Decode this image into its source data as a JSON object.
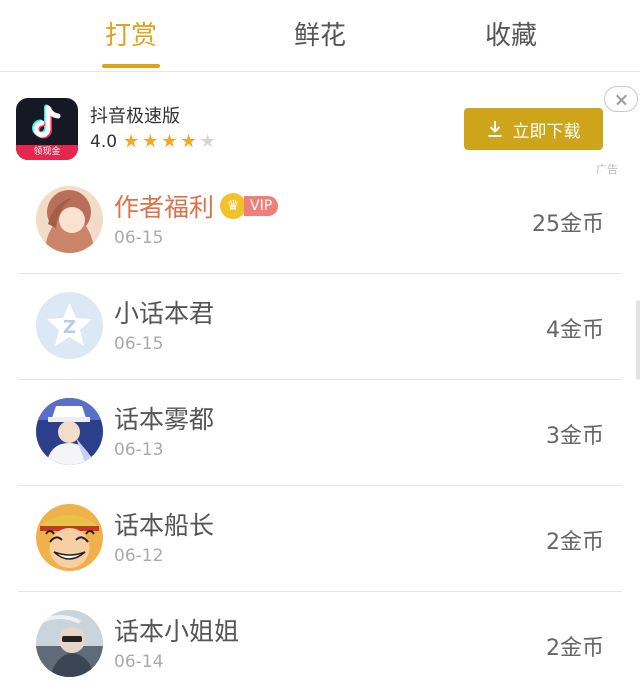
{
  "tabs": [
    {
      "label": "打赏",
      "active": true
    },
    {
      "label": "鲜花",
      "active": false
    },
    {
      "label": "收藏",
      "active": false
    }
  ],
  "ad": {
    "app_name": "抖音极速版",
    "rating": "4.0",
    "stars_filled": 4,
    "stars_total": 5,
    "icon_tag": "领现金",
    "download_label": "立即下载",
    "ad_label": "广告"
  },
  "rewards": [
    {
      "name": "作者福利",
      "date": "06-15",
      "coins": "25金币",
      "vip_badge": "VIP"
    },
    {
      "name": "小话本君",
      "date": "06-15",
      "coins": "4金币"
    },
    {
      "name": "话本雾都",
      "date": "06-13",
      "coins": "3金币"
    },
    {
      "name": "话本船长",
      "date": "06-12",
      "coins": "2金币"
    },
    {
      "name": "话本小姐姐",
      "date": "06-14",
      "coins": "2金币"
    }
  ],
  "colors": {
    "accent": "#e0a21c",
    "button": "#cda41a",
    "vip": "#f07f7c"
  }
}
